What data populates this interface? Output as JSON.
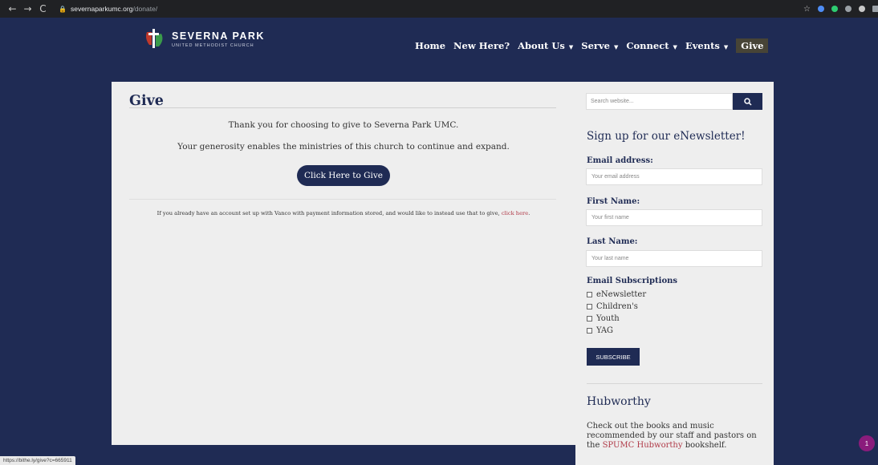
{
  "browser": {
    "url_host": "severnaparkumc.org",
    "url_path": "/donate/"
  },
  "header": {
    "logo_title": "SEVERNA PARK",
    "logo_subtitle": "UNITED METHODIST CHURCH",
    "nav": [
      {
        "label": "Home",
        "has_caret": false
      },
      {
        "label": "New Here?",
        "has_caret": false
      },
      {
        "label": "About Us",
        "has_caret": true
      },
      {
        "label": "Serve",
        "has_caret": true
      },
      {
        "label": "Connect",
        "has_caret": true
      },
      {
        "label": "Events",
        "has_caret": true
      },
      {
        "label": "Give",
        "has_caret": false
      }
    ]
  },
  "main": {
    "title": "Give",
    "thanks": "Thank you for choosing to give to Severna Park UMC.",
    "generosity": "Your generosity enables the ministries of this church to continue and expand.",
    "give_button": "Click Here to Give",
    "vanco_text": "If you already have an account set up with Vanco with payment information stored, and would like to instead use that to give,",
    "vanco_link": "click here",
    "vanco_end": "."
  },
  "sidebar": {
    "search_placeholder": "Search website...",
    "newsletter_title": "Sign up for our eNewsletter!",
    "email_label": "Email address:",
    "email_placeholder": "Your email address",
    "first_label": "First Name:",
    "first_placeholder": "Your first name",
    "last_label": "Last Name:",
    "last_placeholder": "Your last name",
    "subs_label": "Email Subscriptions",
    "subscriptions": [
      "eNewsletter",
      "Children's",
      "Youth",
      "YAG"
    ],
    "subscribe_button": "SUBSCRIBE",
    "hub_title": "Hubworthy",
    "hub_text": "Check out the books and music recommended by our staff and pastors on the",
    "hub_link": "SPUMC Hubworthy",
    "hub_end": "bookshelf."
  },
  "status": {
    "hover_url": "https://bithe.ly/give?c=665911",
    "badge_count": "1"
  },
  "colors": {
    "navy": "#1f2b54",
    "panel": "#eeeeee",
    "link": "#b03a48"
  }
}
